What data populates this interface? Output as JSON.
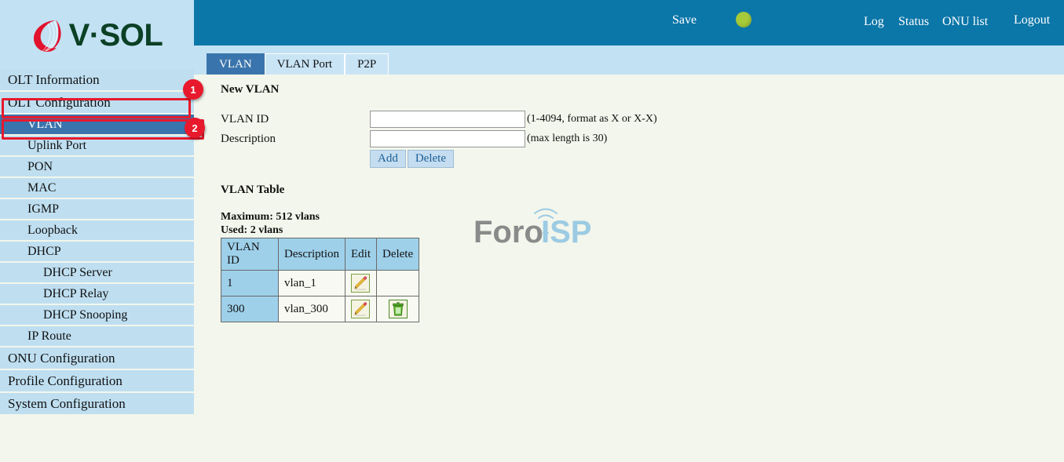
{
  "brand": {
    "name": "V·SOL",
    "logo_icon": "vsol-swirl-logo",
    "text_color": "#0b4024",
    "mark_color": "#e2112d"
  },
  "header": {
    "save_label": "Save",
    "status_led": "status-indicator-green",
    "led_color": "#a6ca3a",
    "links": [
      {
        "label": "Log"
      },
      {
        "label": "Status"
      },
      {
        "label": "ONU list"
      },
      {
        "label": "Logout"
      }
    ],
    "bg_color": "#0b76a8"
  },
  "tabs": [
    {
      "label": "VLAN",
      "active": true
    },
    {
      "label": "VLAN Port",
      "active": false
    },
    {
      "label": "P2P",
      "active": false
    }
  ],
  "sidebar": {
    "items": [
      {
        "label": "OLT Information",
        "level": 0,
        "selected": false
      },
      {
        "label": "OLT Configuration",
        "level": 0,
        "selected": false
      },
      {
        "label": "VLAN",
        "level": 1,
        "selected": true
      },
      {
        "label": "Uplink Port",
        "level": 1,
        "selected": false
      },
      {
        "label": "PON",
        "level": 1,
        "selected": false
      },
      {
        "label": "MAC",
        "level": 1,
        "selected": false
      },
      {
        "label": "IGMP",
        "level": 1,
        "selected": false
      },
      {
        "label": "Loopback",
        "level": 1,
        "selected": false
      },
      {
        "label": "DHCP",
        "level": 1,
        "selected": false
      },
      {
        "label": "DHCP Server",
        "level": 2,
        "selected": false
      },
      {
        "label": "DHCP Relay",
        "level": 2,
        "selected": false
      },
      {
        "label": "DHCP Snooping",
        "level": 2,
        "selected": false
      },
      {
        "label": "IP Route",
        "level": 1,
        "selected": false
      },
      {
        "label": "ONU Configuration",
        "level": 0,
        "selected": false
      },
      {
        "label": "Profile Configuration",
        "level": 0,
        "selected": false
      },
      {
        "label": "System Configuration",
        "level": 0,
        "selected": false
      }
    ]
  },
  "annotations": {
    "color": "#e8192c",
    "badges": [
      {
        "number": "1",
        "targets": "OLT Configuration"
      },
      {
        "number": "2",
        "targets": "VLAN"
      }
    ]
  },
  "main": {
    "new_vlan": {
      "title": "New VLAN",
      "vlan_id_label": "VLAN ID",
      "vlan_id_value": "",
      "vlan_id_hint": "(1-4094, format as X or X-X)",
      "description_label": "Description",
      "description_value": "",
      "description_hint": "(max length is 30)",
      "add_label": "Add",
      "delete_label": "Delete"
    },
    "vlan_table": {
      "title": "VLAN Table",
      "maximum_text": "Maximum: 512 vlans",
      "used_text": "Used: 2 vlans",
      "columns": [
        "VLAN ID",
        "Description",
        "Edit",
        "Delete"
      ],
      "rows": [
        {
          "vlan_id": "1",
          "description": "vlan_1",
          "edit_icon": "edit-pencil-icon",
          "delete_icon": ""
        },
        {
          "vlan_id": "300",
          "description": "vlan_300",
          "edit_icon": "edit-pencil-icon",
          "delete_icon": "delete-trash-icon"
        }
      ]
    }
  },
  "watermark": {
    "text_primary": "Foro",
    "text_secondary": "ISP",
    "icon": "antenna-tower-icon",
    "primary_color": "#8a8a8a",
    "secondary_color": "#9ccbe3"
  }
}
